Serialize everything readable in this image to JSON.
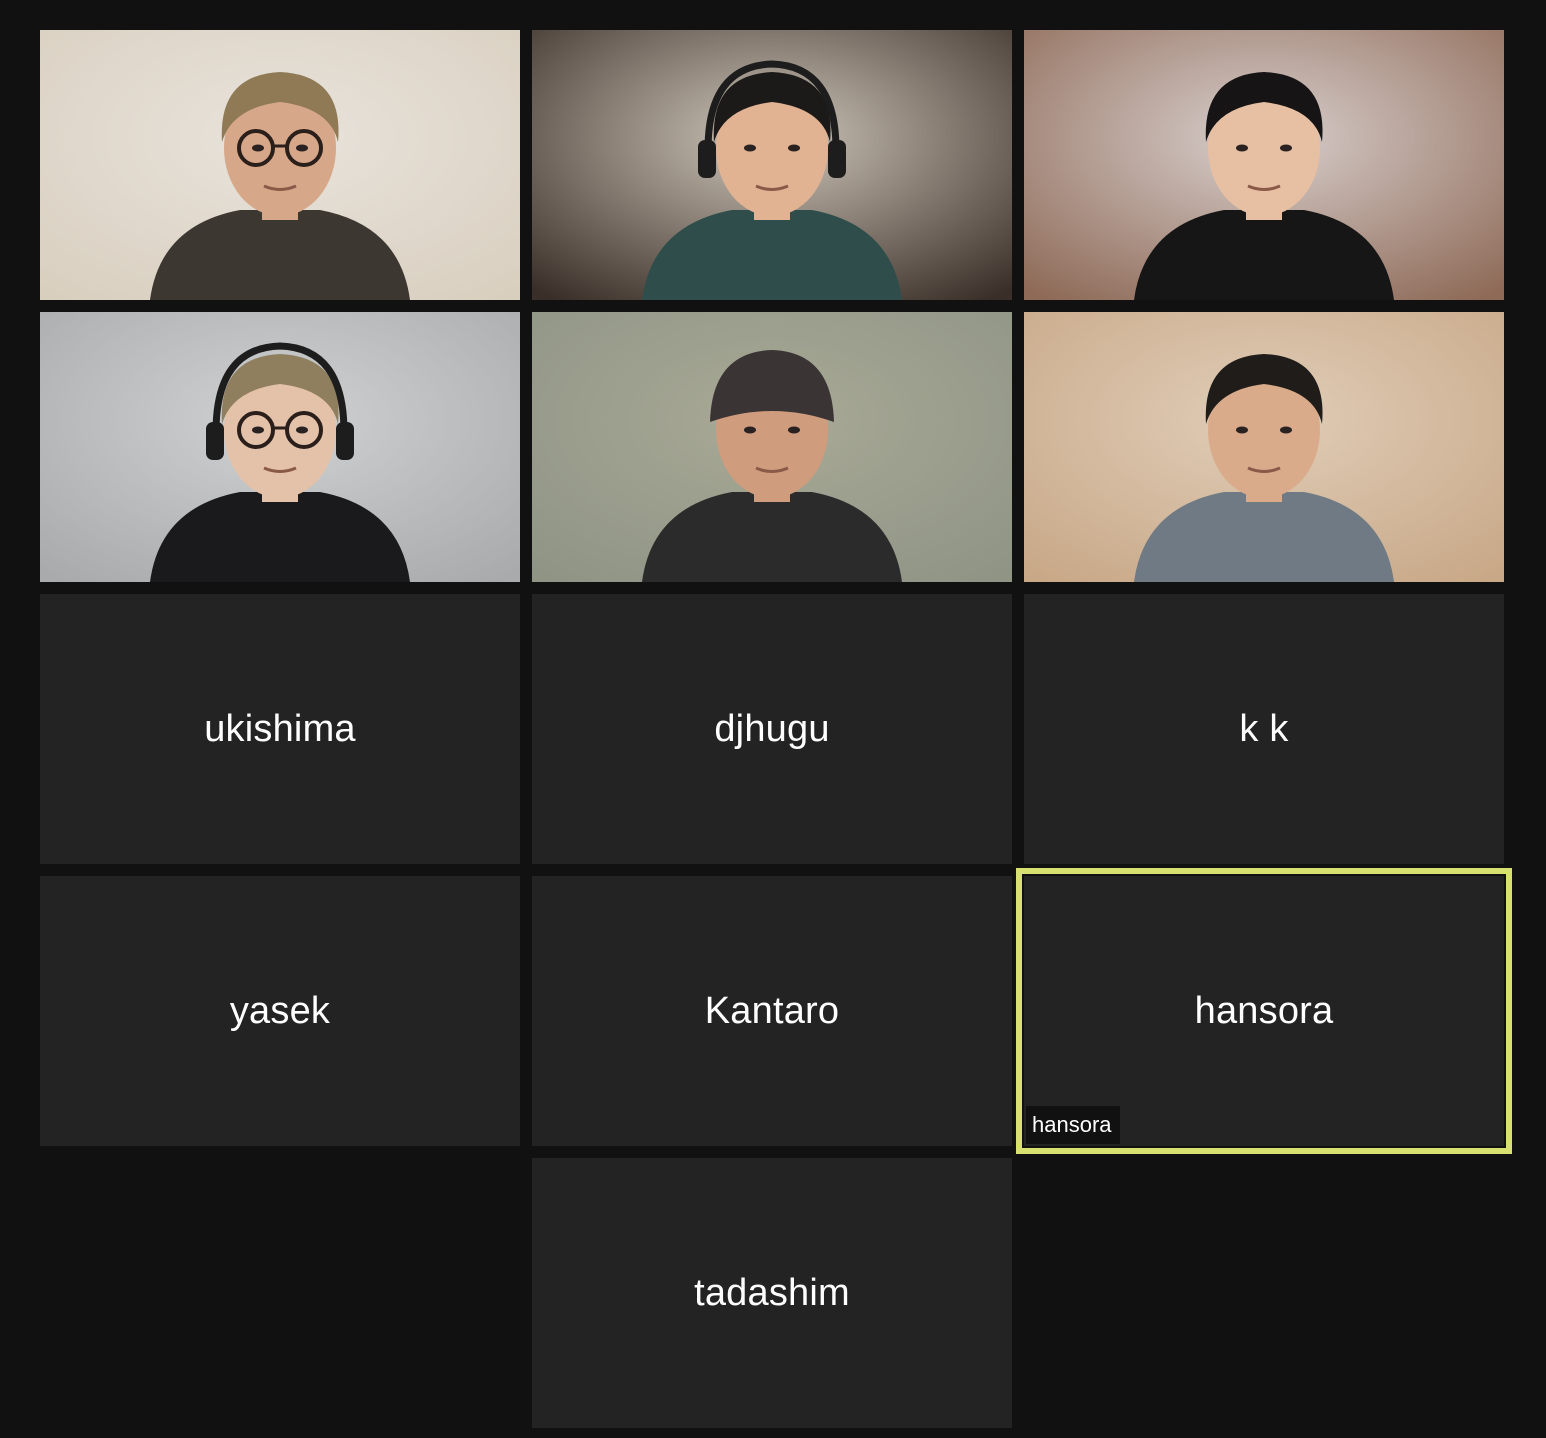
{
  "meeting": {
    "video_tiles": [
      {
        "id": "v1",
        "label": "participant video 1",
        "bg": "#e8e3dc",
        "accent": "#d9cfbf",
        "skin": "#d7a78a",
        "hair": "#8f7a55",
        "shirt": "#3c3730",
        "glasses": true
      },
      {
        "id": "v2",
        "label": "participant video 2",
        "bg": "#cfc6ba",
        "accent": "#3a2f28",
        "skin": "#e1b393",
        "hair": "#1c1a19",
        "shirt": "#2f4d4b",
        "glasses": false,
        "headphones": true
      },
      {
        "id": "v3",
        "label": "participant video 3",
        "bg": "#d8cfcd",
        "accent": "#8e6a57",
        "skin": "#e7c0a4",
        "hair": "#161414",
        "shirt": "#161616",
        "glasses": false
      },
      {
        "id": "v4",
        "label": "participant video 4",
        "bg": "#cfd1d2",
        "accent": "#a8aaac",
        "skin": "#e4c2a9",
        "hair": "#8f7f5f",
        "shirt": "#1a1a1c",
        "glasses": true,
        "headphones": true
      },
      {
        "id": "v5",
        "label": "participant video 5",
        "bg": "#a9a996",
        "accent": "#8f9485",
        "skin": "#cf9c7d",
        "hair": "#3a3434",
        "shirt": "#2b2b2b",
        "glasses": false,
        "beanie": true
      },
      {
        "id": "v6",
        "label": "participant video 6",
        "bg": "#e0cdb8",
        "accent": "#c8a887",
        "skin": "#d9ab8a",
        "hair": "#201c1a",
        "shirt": "#6f7a84",
        "glasses": false
      }
    ],
    "name_tiles": [
      {
        "id": "n1",
        "name": "ukishima"
      },
      {
        "id": "n2",
        "name": "djhugu"
      },
      {
        "id": "n3",
        "name": "k k"
      },
      {
        "id": "n4",
        "name": "yasek"
      },
      {
        "id": "n5",
        "name": "Kantaro"
      },
      {
        "id": "n6",
        "name": "hansora",
        "active_speaker": true,
        "name_tag": "hansora"
      },
      {
        "id": "n7",
        "name": "tadashim"
      }
    ],
    "colors": {
      "background": "#111111",
      "tile": "#232323",
      "active_border": "#d8e070"
    }
  }
}
